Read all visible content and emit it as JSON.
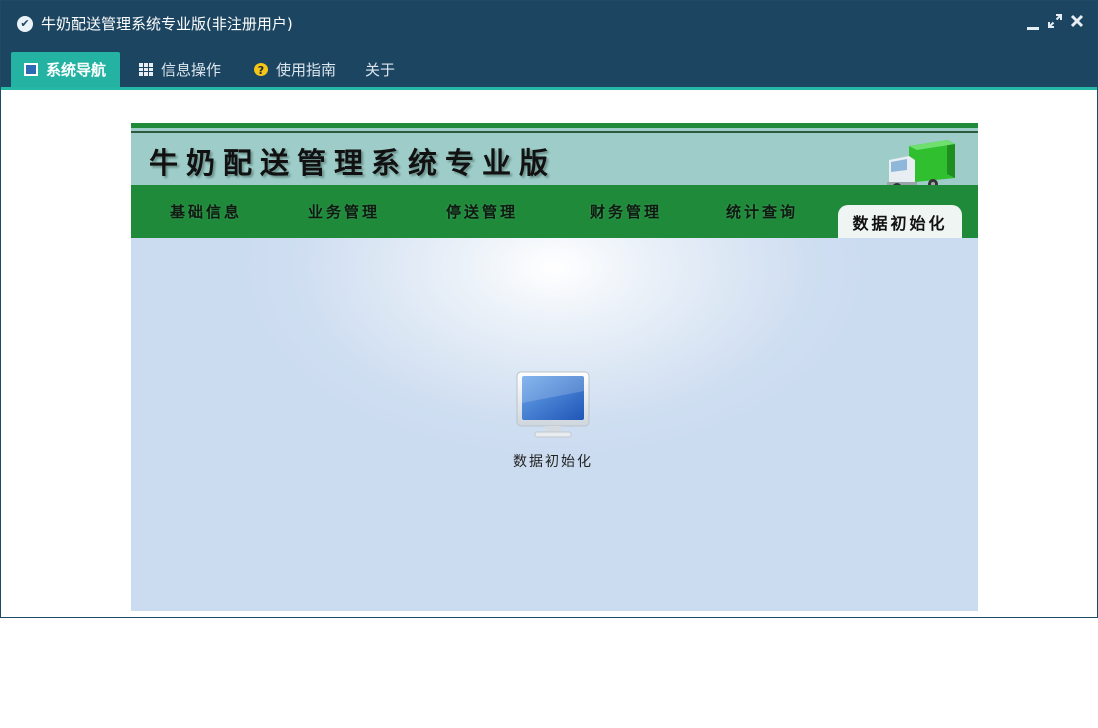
{
  "window": {
    "title": "牛奶配送管理系统专业版(非注册用户)",
    "app_icon_glyph": "✔"
  },
  "menubar": {
    "tabs": [
      {
        "label": "系统导航",
        "icon": "monitor-icon",
        "active": true
      },
      {
        "label": "信息操作",
        "icon": "grid-icon"
      },
      {
        "label": "使用指南",
        "icon": "help-icon"
      },
      {
        "label": "关于",
        "icon": ""
      }
    ]
  },
  "banner": {
    "title": "牛奶配送管理系统专业版",
    "icon": "truck-icon"
  },
  "nav": {
    "items": [
      {
        "label": "基础信息"
      },
      {
        "label": "业务管理"
      },
      {
        "label": "停送管理"
      },
      {
        "label": "财务管理"
      },
      {
        "label": "统计查询"
      },
      {
        "label": "数据初始化",
        "active": true
      }
    ]
  },
  "workarea": {
    "item": {
      "label": "数据初始化",
      "icon": "monitor-icon"
    }
  },
  "colors": {
    "titlebar": "#1c4561",
    "accent": "#24b3a3",
    "nav_green": "#1e8a3a",
    "banner": "#9ecdc9"
  }
}
